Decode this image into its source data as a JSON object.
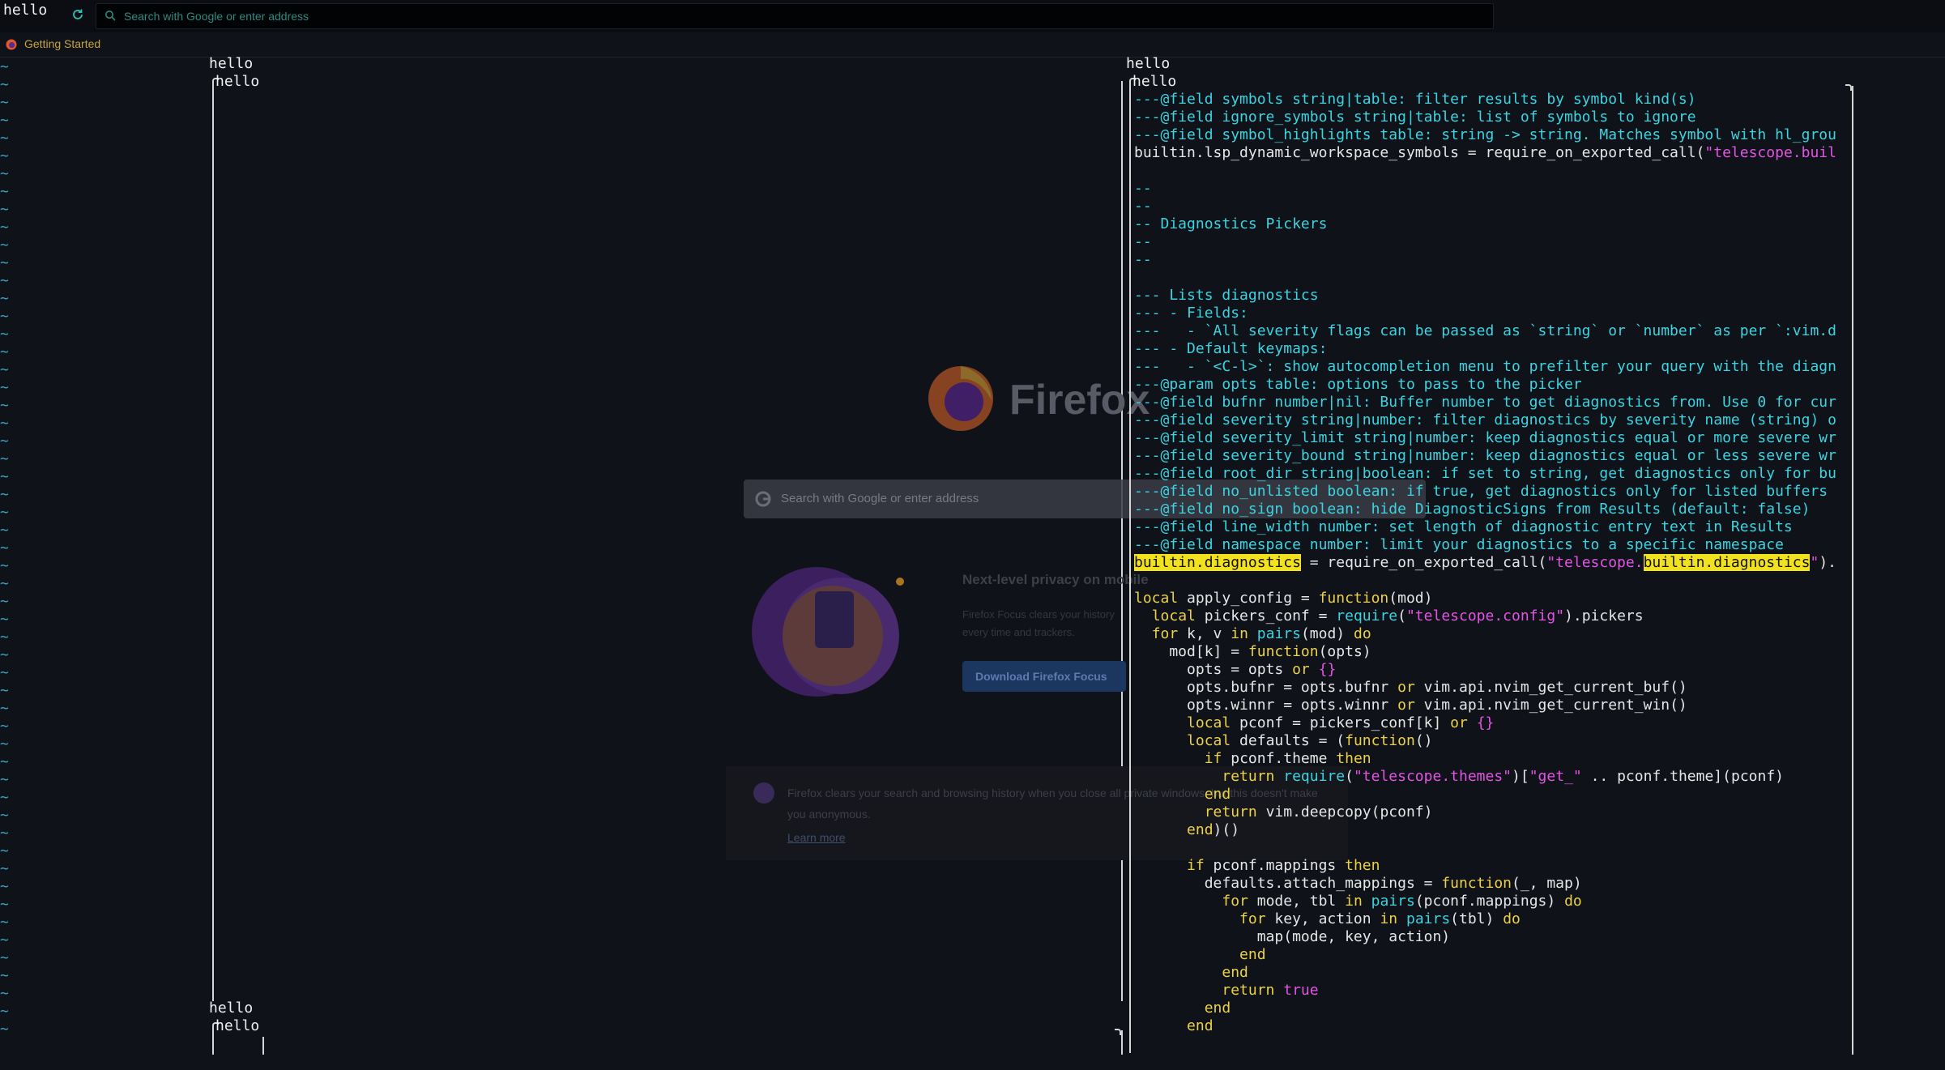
{
  "window": {
    "title": "hello"
  },
  "browser": {
    "url_placeholder": "Search with Google or enter address",
    "bookmark": "Getting Started"
  },
  "panes": {
    "left_top_label": "hello",
    "left_top_inner": "hello",
    "left_bottom_label": "hello",
    "left_bottom_inner": "hello",
    "right_label": "hello",
    "right_inner": "hello"
  },
  "newtab": {
    "brand": "Firefox",
    "search_placeholder": "Search with Google or enter address",
    "promo_title": "Next-level privacy on mobile",
    "promo_body": "Firefox Focus clears your history every time and trackers.",
    "promo_button": "Download Firefox Focus",
    "private_text": "Firefox clears your search and browsing history when you close all private windows, but this doesn't make you anonymous.",
    "learn_more": "Learn more"
  },
  "code": [
    [
      [
        "c",
        "---@field symbols string|table: filter results by symbol kind(s)"
      ]
    ],
    [
      [
        "c",
        "---@field ignore_symbols string|table: list of symbols to ignore"
      ]
    ],
    [
      [
        "c",
        "---@field symbol_highlights table: string -> string. Matches symbol with hl_grou"
      ]
    ],
    [
      [
        "t",
        "builtin.lsp_dynamic_workspace_symbols = require_on_exported_call("
      ],
      [
        "s",
        "\"telescope.buil"
      ]
    ],
    [
      [
        "t",
        ""
      ]
    ],
    [
      [
        "c",
        "--"
      ]
    ],
    [
      [
        "c",
        "--"
      ]
    ],
    [
      [
        "c",
        "-- Diagnostics Pickers"
      ]
    ],
    [
      [
        "c",
        "--"
      ]
    ],
    [
      [
        "c",
        "--"
      ]
    ],
    [
      [
        "t",
        ""
      ]
    ],
    [
      [
        "c",
        "--- Lists diagnostics"
      ]
    ],
    [
      [
        "c",
        "--- - Fields:"
      ]
    ],
    [
      [
        "c",
        "---   - `All severity flags can be passed as `string` or `number` as per `:vim.d"
      ]
    ],
    [
      [
        "c",
        "--- - Default keymaps:"
      ]
    ],
    [
      [
        "c",
        "---   - `<C-l>`: show autocompletion menu to prefilter your query with the diagn"
      ]
    ],
    [
      [
        "c",
        "---@param opts table: options to pass to the picker"
      ]
    ],
    [
      [
        "c",
        "---@field bufnr number|nil: Buffer number to get diagnostics from. Use 0 for cur"
      ]
    ],
    [
      [
        "c",
        "---@field severity string|number: filter diagnostics by severity name (string) o"
      ]
    ],
    [
      [
        "c",
        "---@field severity_limit string|number: keep diagnostics equal or more severe wr"
      ]
    ],
    [
      [
        "c",
        "---@field severity_bound string|number: keep diagnostics equal or less severe wr"
      ]
    ],
    [
      [
        "c",
        "---@field root_dir string|boolean: if set to string, get diagnostics only for bu"
      ]
    ],
    [
      [
        "c",
        "---@field no_unlisted boolean: if true, get diagnostics only for listed buffers"
      ]
    ],
    [
      [
        "c",
        "---@field no_sign boolean: hide DiagnosticSigns from Results (default: false)"
      ]
    ],
    [
      [
        "c",
        "---@field line_width number: set length of diagnostic entry text in Results"
      ]
    ],
    [
      [
        "c",
        "---@field namespace number: limit your diagnostics to a specific namespace"
      ]
    ],
    [
      [
        "hl",
        "builtin.diagnostics"
      ],
      [
        "t",
        " = require_on_exported_call("
      ],
      [
        "s",
        "\"telescope."
      ],
      [
        "hs",
        "builtin.diagnostics"
      ],
      [
        "s",
        "\""
      ],
      [
        "t",
        ")."
      ]
    ],
    [
      [
        "t",
        ""
      ]
    ],
    [
      [
        "k",
        "local"
      ],
      [
        "t",
        " apply_config = "
      ],
      [
        "k",
        "function"
      ],
      [
        "t",
        "(mod)"
      ]
    ],
    [
      [
        "t",
        "  "
      ],
      [
        "k",
        "local"
      ],
      [
        "t",
        " pickers_conf = "
      ],
      [
        "f",
        "require"
      ],
      [
        "t",
        "("
      ],
      [
        "s",
        "\"telescope.config\""
      ],
      [
        "t",
        ").pickers"
      ]
    ],
    [
      [
        "t",
        "  "
      ],
      [
        "k",
        "for"
      ],
      [
        "t",
        " k, v "
      ],
      [
        "k",
        "in"
      ],
      [
        "t",
        " "
      ],
      [
        "f",
        "pairs"
      ],
      [
        "t",
        "(mod) "
      ],
      [
        "k",
        "do"
      ]
    ],
    [
      [
        "t",
        "    mod[k] = "
      ],
      [
        "k",
        "function"
      ],
      [
        "t",
        "(opts)"
      ]
    ],
    [
      [
        "t",
        "      opts = opts "
      ],
      [
        "k",
        "or"
      ],
      [
        "t",
        " "
      ],
      [
        "s",
        "{}"
      ]
    ],
    [
      [
        "t",
        "      opts.bufnr = opts.bufnr "
      ],
      [
        "k",
        "or"
      ],
      [
        "t",
        " vim.api.nvim_get_current_buf()"
      ]
    ],
    [
      [
        "t",
        "      opts.winnr = opts.winnr "
      ],
      [
        "k",
        "or"
      ],
      [
        "t",
        " vim.api.nvim_get_current_win()"
      ]
    ],
    [
      [
        "t",
        "      "
      ],
      [
        "k",
        "local"
      ],
      [
        "t",
        " pconf = pickers_conf[k] "
      ],
      [
        "k",
        "or"
      ],
      [
        "t",
        " "
      ],
      [
        "s",
        "{}"
      ]
    ],
    [
      [
        "t",
        "      "
      ],
      [
        "k",
        "local"
      ],
      [
        "t",
        " defaults = ("
      ],
      [
        "k",
        "function"
      ],
      [
        "t",
        "()"
      ]
    ],
    [
      [
        "t",
        "        "
      ],
      [
        "k",
        "if"
      ],
      [
        "t",
        " pconf.theme "
      ],
      [
        "k",
        "then"
      ]
    ],
    [
      [
        "t",
        "          "
      ],
      [
        "k",
        "return"
      ],
      [
        "t",
        " "
      ],
      [
        "f",
        "require"
      ],
      [
        "t",
        "("
      ],
      [
        "s",
        "\"telescope.themes\""
      ],
      [
        "t",
        ")["
      ],
      [
        "s",
        "\"get_\""
      ],
      [
        "t",
        " .. pconf.theme](pconf)"
      ]
    ],
    [
      [
        "t",
        "        "
      ],
      [
        "k",
        "end"
      ]
    ],
    [
      [
        "t",
        "        "
      ],
      [
        "k",
        "return"
      ],
      [
        "t",
        " vim.deepcopy(pconf)"
      ]
    ],
    [
      [
        "t",
        "      "
      ],
      [
        "k",
        "end"
      ],
      [
        "t",
        ")()"
      ]
    ],
    [
      [
        "t",
        ""
      ]
    ],
    [
      [
        "t",
        "      "
      ],
      [
        "k",
        "if"
      ],
      [
        "t",
        " pconf.mappings "
      ],
      [
        "k",
        "then"
      ]
    ],
    [
      [
        "t",
        "        defaults.attach_mappings = "
      ],
      [
        "k",
        "function"
      ],
      [
        "t",
        "(_, map)"
      ]
    ],
    [
      [
        "t",
        "          "
      ],
      [
        "k",
        "for"
      ],
      [
        "t",
        " mode, tbl "
      ],
      [
        "k",
        "in"
      ],
      [
        "t",
        " "
      ],
      [
        "f",
        "pairs"
      ],
      [
        "t",
        "(pconf.mappings) "
      ],
      [
        "k",
        "do"
      ]
    ],
    [
      [
        "t",
        "            "
      ],
      [
        "k",
        "for"
      ],
      [
        "t",
        " key, action "
      ],
      [
        "k",
        "in"
      ],
      [
        "t",
        " "
      ],
      [
        "f",
        "pairs"
      ],
      [
        "t",
        "(tbl) "
      ],
      [
        "k",
        "do"
      ]
    ],
    [
      [
        "t",
        "              map(mode, key, action)"
      ]
    ],
    [
      [
        "t",
        "            "
      ],
      [
        "k",
        "end"
      ]
    ],
    [
      [
        "t",
        "          "
      ],
      [
        "k",
        "end"
      ]
    ],
    [
      [
        "t",
        "          "
      ],
      [
        "k",
        "return"
      ],
      [
        "t",
        " "
      ],
      [
        "s",
        "true"
      ]
    ],
    [
      [
        "t",
        "        "
      ],
      [
        "k",
        "end"
      ]
    ],
    [
      [
        "t",
        "      "
      ],
      [
        "k",
        "end"
      ]
    ]
  ],
  "tilde_count": 55,
  "tilde_char": "~",
  "colors": {
    "background": "#0f1218",
    "comment": "#3dd3e0",
    "keyword": "#ebd24a",
    "string": "#e255e2",
    "search_highlight": "#f1e11f",
    "tilde": "#33a4c2"
  }
}
